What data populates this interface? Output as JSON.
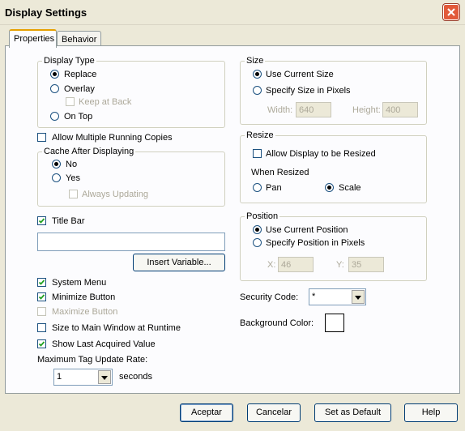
{
  "window": {
    "title": "Display Settings"
  },
  "tabs": [
    {
      "label": "Properties"
    },
    {
      "label": "Behavior"
    }
  ],
  "display_type": {
    "title": "Display Type",
    "options": {
      "replace": "Replace",
      "overlay": "Overlay",
      "on_top": "On Top"
    },
    "selected": "Replace",
    "keep_at_back": "Keep at Back"
  },
  "allow_multiple": {
    "label": "Allow Multiple Running Copies",
    "checked": false
  },
  "cache": {
    "title": "Cache After Displaying",
    "options": {
      "no": "No",
      "yes": "Yes"
    },
    "selected": "No",
    "always_updating": "Always Updating"
  },
  "title_bar": {
    "label": "Title Bar",
    "checked": true,
    "value": "",
    "insert_variable": "Insert Variable..."
  },
  "checks": {
    "system_menu": "System Menu",
    "minimize_button": "Minimize Button",
    "maximize_button": "Maximize Button",
    "size_to_main": "Size to Main Window at Runtime",
    "show_last": "Show Last Acquired Value"
  },
  "tag_rate": {
    "label": "Maximum Tag Update Rate:",
    "value": "1",
    "unit": "seconds"
  },
  "size": {
    "title": "Size",
    "use_current": "Use Current Size",
    "specify": "Specify Size in Pixels",
    "selected": "Use Current Size",
    "width_label": "Width:",
    "width": "640",
    "height_label": "Height:",
    "height": "400"
  },
  "resize": {
    "title": "Resize",
    "allow": "Allow Display to be Resized",
    "when_resized": "When Resized",
    "pan": "Pan",
    "scale": "Scale",
    "selected": "Scale"
  },
  "position": {
    "title": "Position",
    "use_current": "Use Current Position",
    "specify": "Specify Position in Pixels",
    "selected": "Use Current Position",
    "x_label": "X:",
    "x": "46",
    "y_label": "Y:",
    "y": "35"
  },
  "security": {
    "label": "Security Code:",
    "value": "*"
  },
  "background": {
    "label": "Background Color:",
    "color": "#ffffff"
  },
  "buttons": {
    "ok": "Aceptar",
    "cancel": "Cancelar",
    "set_default": "Set as Default",
    "help": "Help"
  }
}
